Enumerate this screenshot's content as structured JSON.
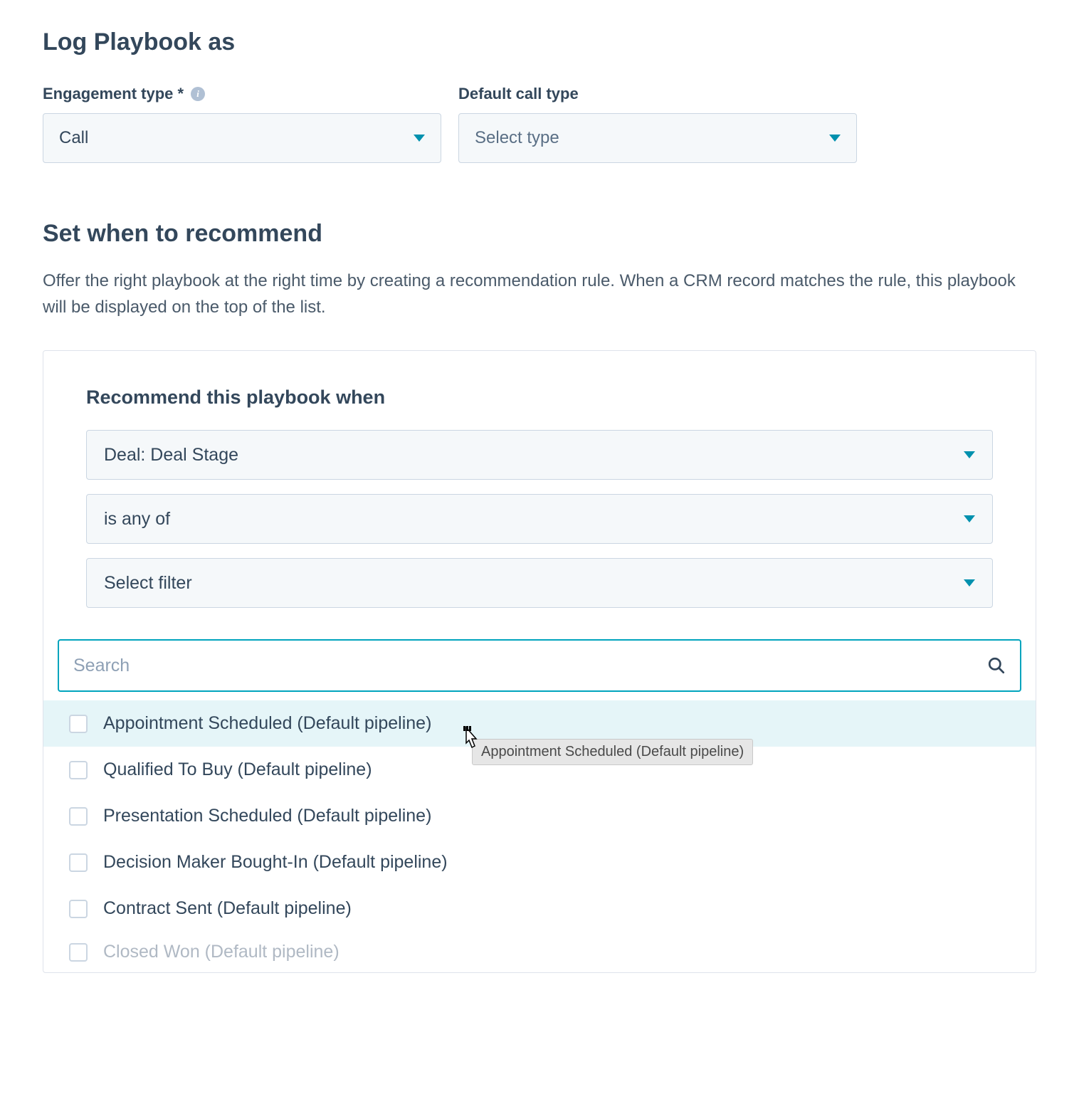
{
  "logPlaybook": {
    "title": "Log Playbook as",
    "engagementLabel": "Engagement type *",
    "engagementValue": "Call",
    "defaultCallLabel": "Default call type",
    "defaultCallPlaceholder": "Select type"
  },
  "recommend": {
    "title": "Set when to recommend",
    "description": "Offer the right playbook at the right time by creating a recommendation rule. When a CRM record matches the rule, this playbook will be displayed on the top of the list.",
    "ruleTitle": "Recommend this playbook when",
    "propertySelect": "Deal: Deal Stage",
    "operatorSelect": "is any of",
    "filterPlaceholder": "Select filter",
    "searchPlaceholder": "Search",
    "options": [
      "Appointment Scheduled (Default pipeline)",
      "Qualified To Buy (Default pipeline)",
      "Presentation Scheduled (Default pipeline)",
      "Decision Maker Bought-In (Default pipeline)",
      "Contract Sent (Default pipeline)",
      "Closed Won (Default pipeline)"
    ],
    "tooltip": "Appointment Scheduled (Default pipeline)"
  }
}
